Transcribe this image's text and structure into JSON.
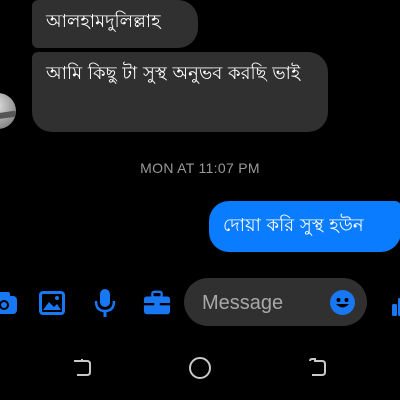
{
  "conversation": {
    "messages": [
      {
        "direction": "incoming",
        "text": "আলহামদুলিল্লাহ"
      },
      {
        "direction": "incoming",
        "text": "আমি কিছু টা সুস্থ অনুভব করছি ভাই"
      },
      {
        "direction": "outgoing",
        "text": "দোয়া করি সুস্থ হউন"
      }
    ],
    "timestamp": "MON AT 11:07 PM"
  },
  "composer": {
    "placeholder": "Message",
    "tools": [
      "camera-icon",
      "photo-icon",
      "microphone-icon",
      "toolbox-icon"
    ],
    "emoji_icon": "emoji-icon",
    "right_icon": "thumb-icon"
  },
  "navbar": {
    "items": [
      "recent-apps-icon",
      "home-icon",
      "back-icon"
    ]
  },
  "colors": {
    "background": "#000000",
    "incoming_bubble": "#303030",
    "outgoing_bubble": "#0a7cff",
    "accent": "#1877f2",
    "timestamp": "#9a9a9a"
  }
}
